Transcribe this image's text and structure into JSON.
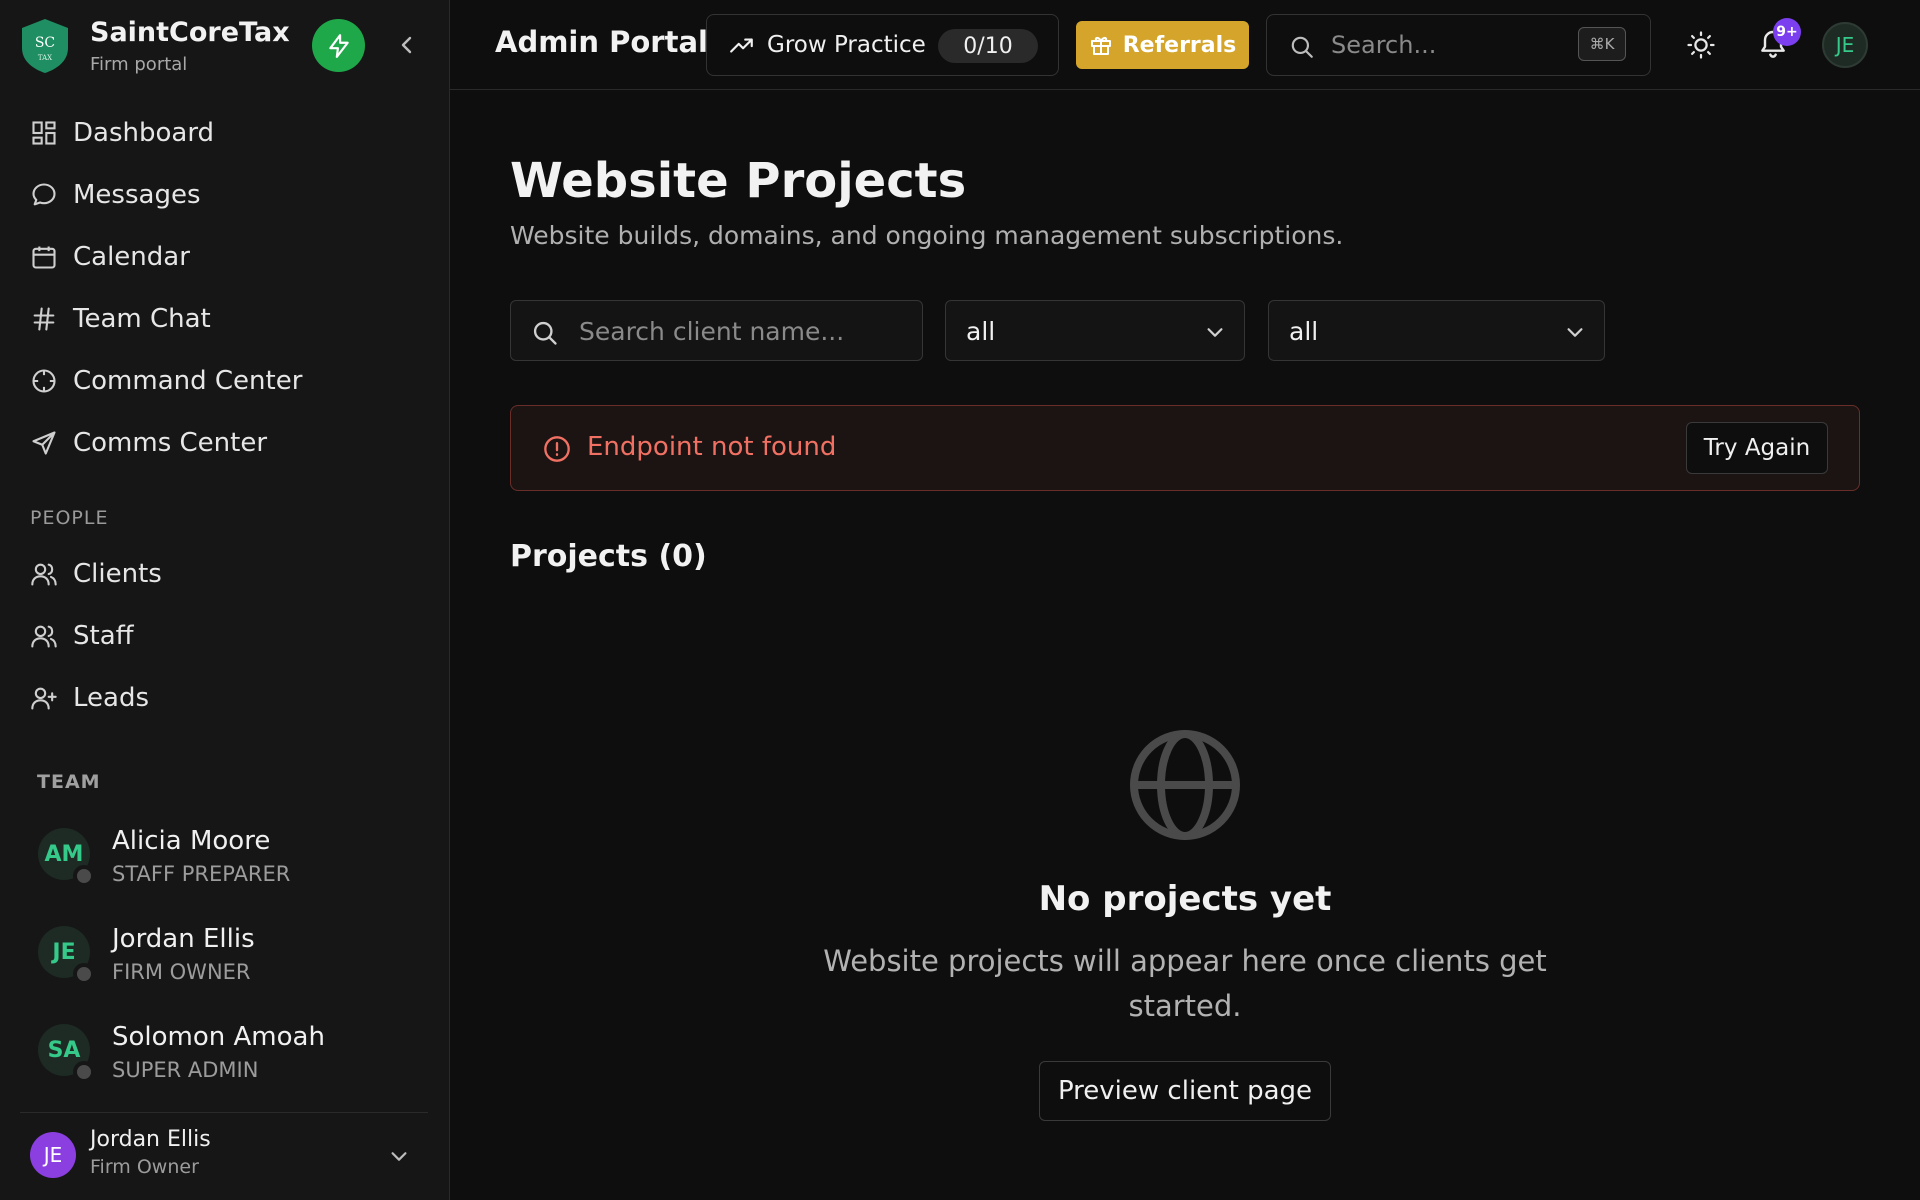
{
  "brand": {
    "logo_text": "SC",
    "logo_sub": "TAX",
    "name": "SaintCoreTax",
    "subtitle": "Firm portal"
  },
  "sidebar": {
    "nav": [
      {
        "label": "Dashboard",
        "icon": "dashboard-icon"
      },
      {
        "label": "Messages",
        "icon": "message-icon"
      },
      {
        "label": "Calendar",
        "icon": "calendar-icon"
      },
      {
        "label": "Team Chat",
        "icon": "hash-icon"
      },
      {
        "label": "Command Center",
        "icon": "crosshair-icon"
      },
      {
        "label": "Comms Center",
        "icon": "send-icon"
      }
    ],
    "people_label": "PEOPLE",
    "people": [
      {
        "label": "Clients",
        "icon": "users-icon"
      },
      {
        "label": "Staff",
        "icon": "users-icon"
      },
      {
        "label": "Leads",
        "icon": "user-plus-icon"
      }
    ],
    "team_label": "TEAM",
    "team": [
      {
        "initials": "AM",
        "name": "Alicia Moore",
        "role": "STAFF PREPARER"
      },
      {
        "initials": "JE",
        "name": "Jordan Ellis",
        "role": "FIRM OWNER"
      },
      {
        "initials": "SA",
        "name": "Solomon Amoah",
        "role": "SUPER ADMIN"
      }
    ],
    "footer": {
      "initials": "JE",
      "name": "Jordan Ellis",
      "role": "Firm Owner"
    }
  },
  "header": {
    "title": "Admin Portal",
    "grow_label": "Grow Practice",
    "grow_count": "0/10",
    "referrals_label": "Referrals",
    "search_placeholder": "Search...",
    "search_shortcut": "⌘K",
    "notification_badge": "9+",
    "avatar_initials": "JE"
  },
  "main": {
    "title": "Website Projects",
    "subtitle": "Website builds, domains, and ongoing management subscriptions.",
    "filters": {
      "search_placeholder": "Search client name...",
      "select_1": "all",
      "select_2": "all"
    },
    "alert": {
      "message": "Endpoint not found",
      "retry_label": "Try Again"
    },
    "projects_title": "Projects (0)",
    "empty": {
      "title": "No projects yet",
      "text": "Website projects will appear here once clients get started.",
      "button": "Preview client page"
    }
  },
  "colors": {
    "background": "#0e0e0e",
    "sidebar": "#161616",
    "accent_green": "#1fa84a",
    "referrals_gold": "#d4a52a",
    "error_red": "#f07163",
    "badge_purple": "#7b3ff0",
    "avatar_teal": "#35c98a"
  }
}
